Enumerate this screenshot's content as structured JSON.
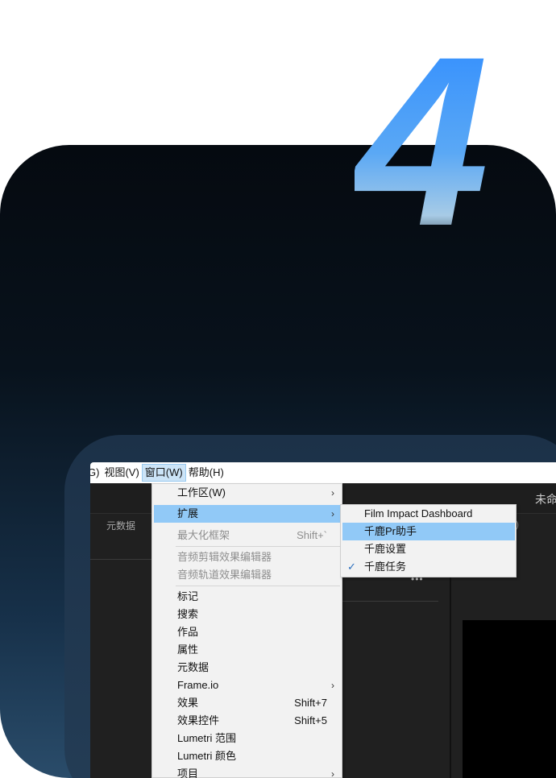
{
  "hero": {
    "number": "4"
  },
  "menubar": {
    "items": [
      {
        "label": "G)"
      },
      {
        "label": "视图(V)"
      },
      {
        "label": "窗口(W)"
      },
      {
        "label": "帮助(H)"
      }
    ]
  },
  "app": {
    "title": "未命",
    "panel_tab": "元数据",
    "paren": ")",
    "dots": "•••"
  },
  "window_menu": {
    "items": [
      {
        "label": "工作区(W)",
        "arrow": "›"
      },
      {
        "label": "扩展",
        "arrow": "›"
      },
      {
        "label": "最大化框架",
        "shortcut": "Shift+`"
      },
      {
        "label": "音频剪辑效果编辑器"
      },
      {
        "label": "音频轨道效果编辑器"
      },
      {
        "label": "标记"
      },
      {
        "label": "搜索"
      },
      {
        "label": "作品"
      },
      {
        "label": "属性"
      },
      {
        "label": "元数据"
      },
      {
        "label": "Frame.io",
        "arrow": "›"
      },
      {
        "label": "效果",
        "shortcut": "Shift+7"
      },
      {
        "label": "效果控件",
        "shortcut": "Shift+5"
      },
      {
        "label": "Lumetri 范围"
      },
      {
        "label": "Lumetri 颜色"
      },
      {
        "label": "项目",
        "arrow": "›"
      }
    ]
  },
  "extensions_submenu": {
    "items": [
      {
        "label": "Film Impact Dashboard"
      },
      {
        "label": "千鹿Pr助手"
      },
      {
        "label": "千鹿设置"
      },
      {
        "label": "千鹿任务",
        "check": "✓"
      }
    ]
  }
}
